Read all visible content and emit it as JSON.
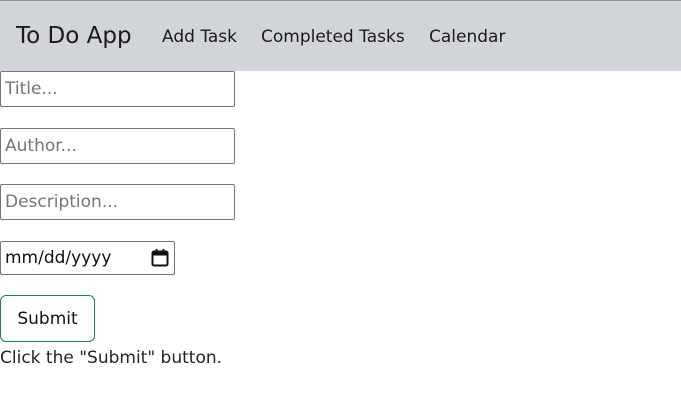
{
  "navbar": {
    "brand": "To Do App",
    "links": [
      {
        "label": "Add Task"
      },
      {
        "label": "Completed Tasks"
      },
      {
        "label": "Calendar"
      }
    ]
  },
  "form": {
    "title": {
      "placeholder": "Title...",
      "value": ""
    },
    "author": {
      "placeholder": "Author...",
      "value": ""
    },
    "description": {
      "placeholder": "Description...",
      "value": ""
    },
    "date": {
      "display": "mm/dd/yyyy",
      "icon": "calendar-icon"
    },
    "submit_label": "Submit",
    "submit_border_color": "#198754"
  },
  "hint_text": "Click the \"Submit\" button.",
  "colors": {
    "navbar_background": "#d1d5da",
    "submit_border": "#198754"
  }
}
